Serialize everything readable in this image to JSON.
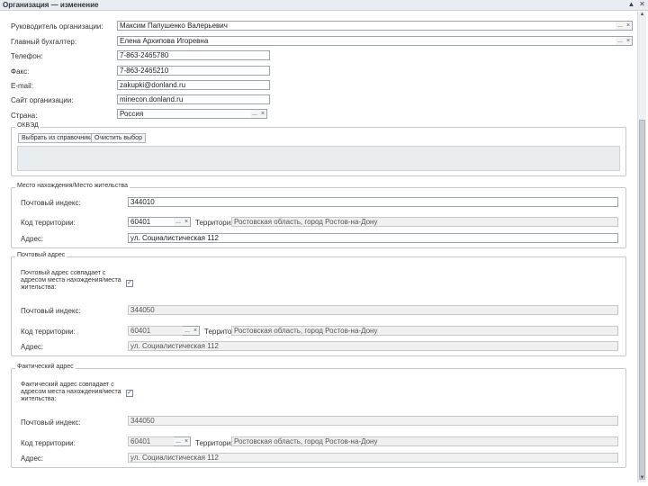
{
  "window": {
    "title": "Организация — изменение",
    "scroll_icon": "triangle-up-icon",
    "close_icon": "close-icon",
    "scroll_down_icon": "triangle-down-icon"
  },
  "top": {
    "head_label": "Руководитель организации:",
    "head_value": "Максим Папушенко Валерьевич",
    "accountant_label": "Главный бухгалтер:",
    "accountant_value": "Елена Архипова Игоревна",
    "phone_label": "Телефон:",
    "phone_value": "7-863-2465780",
    "fax_label": "Факс:",
    "fax_value": "7-863-2465210",
    "email_label": "E-mail:",
    "email_value": "zakupki@donland.ru",
    "site_label": "Сайт организации:",
    "site_value": "minecon.donland.ru",
    "country_label": "Страна:",
    "country_value": "Россия",
    "dots": "...",
    "x": "×"
  },
  "okved": {
    "title": "ОКВЭД",
    "btn_add": "Выбрать из справочника",
    "btn_clear": "Очистить выбор"
  },
  "place": {
    "title": "Место нахождения/Место жительства",
    "zip_label": "Почтовый индекс:",
    "zip_value": "344010",
    "terr_code_label": "Код территории:",
    "terr_code_value": "60401",
    "terr_label": "Территория:",
    "terr_value": "Ростовская область, город Ростов-на-Дону",
    "addr_label": "Адрес:",
    "addr_value": "ул. Социалистическая 112"
  },
  "postal": {
    "title": "Почтовый адрес",
    "same_label": "Почтовый адрес совпадает с адресом места нахождения/места жительства:",
    "same_checked": "✓",
    "zip_label": "Почтовый индекс:",
    "zip_value": "344050",
    "terr_code_label": "Код территории:",
    "terr_code_value": "60401",
    "terr_label": "Территория:",
    "terr_value": "Ростовская область, город Ростов-на-Дону",
    "addr_label": "Адрес:",
    "addr_value": "ул. Социалистическая 112"
  },
  "actual": {
    "title": "Фактический адрес",
    "same_label": "Фактический адрес совпадает с адресом места нахождения/места жительства:",
    "same_checked": "✓",
    "zip_label": "Почтовый индекс:",
    "zip_value": "344050",
    "terr_code_label": "Код территории:",
    "terr_code_value": "60401",
    "terr_label": "Территория:",
    "terr_value": "Ростовская область, город Ростов-на-Дону",
    "addr_label": "Адрес:",
    "addr_value": "ул. Социалистическая 112"
  }
}
